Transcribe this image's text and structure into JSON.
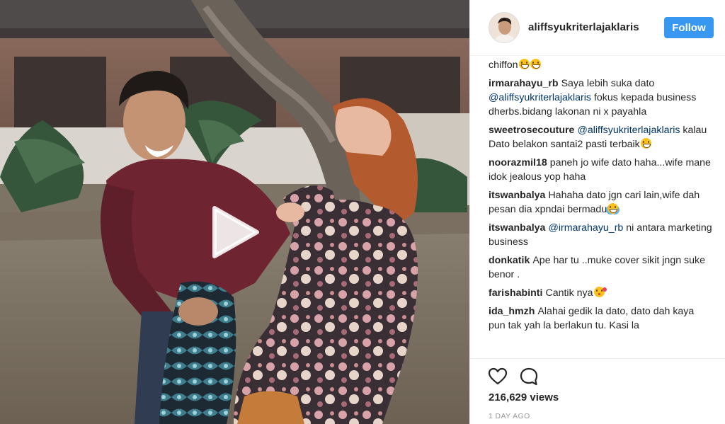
{
  "post": {
    "username": "aliffsyukriterlajaklaris",
    "follow_label": "Follow",
    "views": "216,629 views",
    "time": "1 DAY AGO"
  },
  "comments": [
    {
      "author": "",
      "parts": [
        {
          "text": "chiffon"
        }
      ],
      "emojis": [
        "grin",
        "grin"
      ]
    },
    {
      "author": "irmarahayu_rb",
      "parts": [
        {
          "text": "Saya lebih suka dato "
        },
        {
          "text": "@aliffsyukriterlajaklaris",
          "mention": true
        },
        {
          "text": " fokus kepada business dherbs.bidang lakonan ni x payahla"
        }
      ],
      "emojis": []
    },
    {
      "author": "sweetrosecouture",
      "parts": [
        {
          "text": "@aliffsyukriterlajaklaris",
          "mention": true
        },
        {
          "text": " kalau Dato belakon santai2 pasti terbaik"
        }
      ],
      "emojis": [
        "grin"
      ]
    },
    {
      "author": "noorazmil18",
      "parts": [
        {
          "text": "paneh jo wife dato haha...wife mane idok jealous yop haha"
        }
      ],
      "emojis": []
    },
    {
      "author": "itswanbalya",
      "parts": [
        {
          "text": "Hahaha dato jgn cari lain,wife dah pesan dia xpndai bermadu"
        }
      ],
      "emojis": [
        "tears"
      ]
    },
    {
      "author": "itswanbalya",
      "parts": [
        {
          "text": "@irmarahayu_rb",
          "mention": true
        },
        {
          "text": " ni antara marketing business"
        }
      ],
      "emojis": []
    },
    {
      "author": "donkatik",
      "parts": [
        {
          "text": "Ape har tu ..muke cover sikit jngn suke benor ."
        }
      ],
      "emojis": []
    },
    {
      "author": "farishabinti",
      "parts": [
        {
          "text": "Cantik nya"
        }
      ],
      "emojis": [
        "kiss"
      ]
    },
    {
      "author": "ida_hmzh",
      "parts": [
        {
          "text": "Alahai gedik la dato, dato dah kaya pun tak yah la berlakun tu. Kasi la"
        }
      ],
      "emojis": []
    }
  ],
  "icons": {
    "play": "play-icon",
    "like": "heart-outline-icon",
    "comment": "speech-bubble-icon",
    "avatar": "profile-photo"
  },
  "colors": {
    "follow_button": "#3897f0",
    "mention": "#003569",
    "text": "#262626",
    "timestamp": "#999999",
    "divider": "#efefef"
  }
}
